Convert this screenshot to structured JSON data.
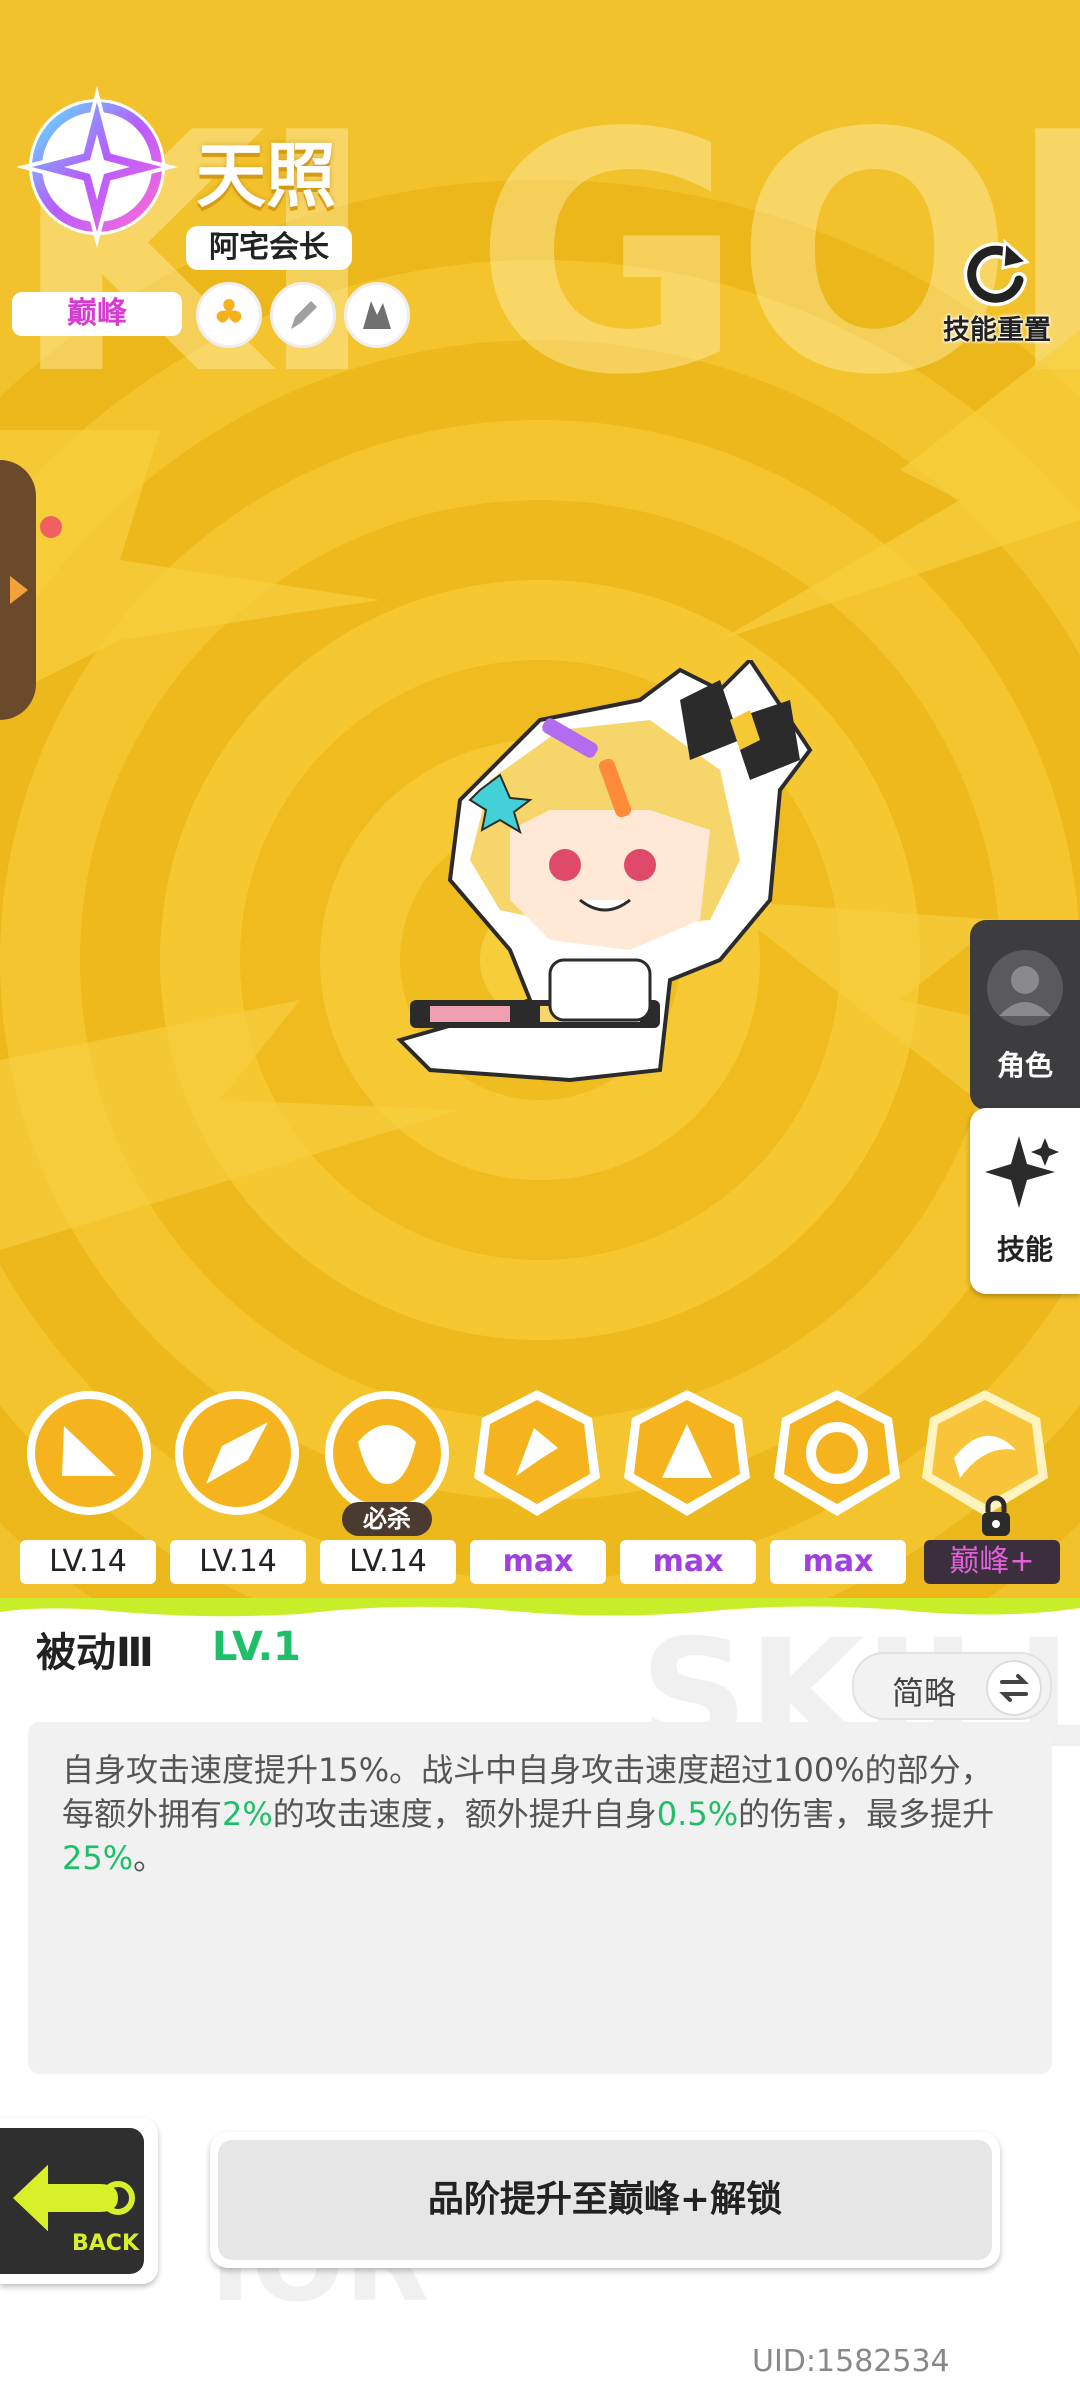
{
  "character": {
    "name": "天照",
    "title": "阿宅会长",
    "rank": "巅峰",
    "background_word": "KI GOD"
  },
  "header": {
    "reset_label": "技能重置"
  },
  "side_tabs": [
    {
      "label": "角色"
    },
    {
      "label": "技能"
    }
  ],
  "skills": [
    {
      "level": "LV.14"
    },
    {
      "level": "LV.14"
    },
    {
      "level": "LV.14",
      "tag": "必杀"
    },
    {
      "level": "max"
    },
    {
      "level": "max"
    },
    {
      "level": "max"
    },
    {
      "level": "巅峰+"
    }
  ],
  "selected_skill": {
    "name": "被动Ⅲ",
    "level": "LV.1",
    "toggle_label": "简略",
    "description": {
      "p1": "自身攻击速度提升15%。战斗中自身攻击速度超过100%的部分，每额外拥有",
      "v1": "2%",
      "p2": "的攻击速度，额外提升自身",
      "v2": "0.5%",
      "p3": "的伤害，最多提升",
      "v3": "25%",
      "p4": "。"
    }
  },
  "footer": {
    "back_label": "BACK",
    "upgrade_label": "品阶提升至巅峰+解锁",
    "uid": "UID:1582534",
    "watermark_1": "SKILL",
    "watermark_2": "IOR"
  },
  "colors": {
    "bg_yellow": "#f2b71a",
    "green_highlight": "#1fbf6a",
    "peak_pink": "#d63cd4"
  }
}
